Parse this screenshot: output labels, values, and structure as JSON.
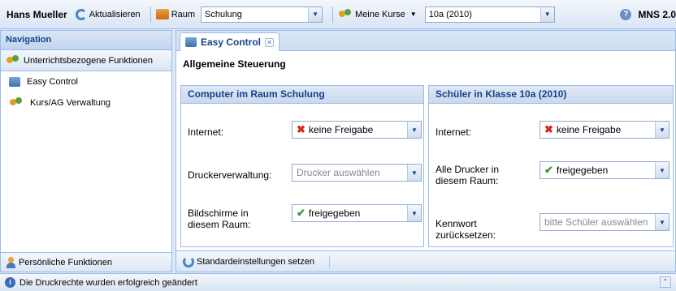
{
  "topbar": {
    "user": "Hans Mueller",
    "refresh_label": "Aktualisieren",
    "room_label": "Raum",
    "room_value": "Schulung",
    "courses_label": "Meine Kurse",
    "courses_value": "10a (2010)",
    "server_label": "MNS 2.0"
  },
  "nav": {
    "title": "Navigation",
    "section_label": "Unterrichtsbezogene Funktionen",
    "items": [
      {
        "label": "Easy Control"
      },
      {
        "label": "Kurs/AG Verwaltung"
      }
    ],
    "bottom_label": "Persönliche Funktionen"
  },
  "main": {
    "tab_label": "Easy Control",
    "section_title": "Allgemeine Steuerung",
    "computer_panel": {
      "title": "Computer im Raum Schulung",
      "internet_label": "Internet:",
      "internet_value": "keine Freigabe",
      "printer_label": "Druckerverwaltung:",
      "printer_placeholder": "Drucker auswählen",
      "screens_label": "Bildschirme in diesem Raum:",
      "screens_value": "freigegeben"
    },
    "student_panel": {
      "title": "Schüler in Klasse 10a (2010)",
      "internet_label": "Internet:",
      "internet_value": "keine Freigabe",
      "printers_label": "Alle Drucker in diesem Raum:",
      "printers_value": "freigegeben",
      "password_label": "Kennwort zurücksetzen:",
      "password_placeholder": "bitte Schüler auswählen"
    },
    "defaults_button": "Standardeinstellungen setzen"
  },
  "status": {
    "message": "Die Druckrechte wurden erfolgreich geändert"
  }
}
